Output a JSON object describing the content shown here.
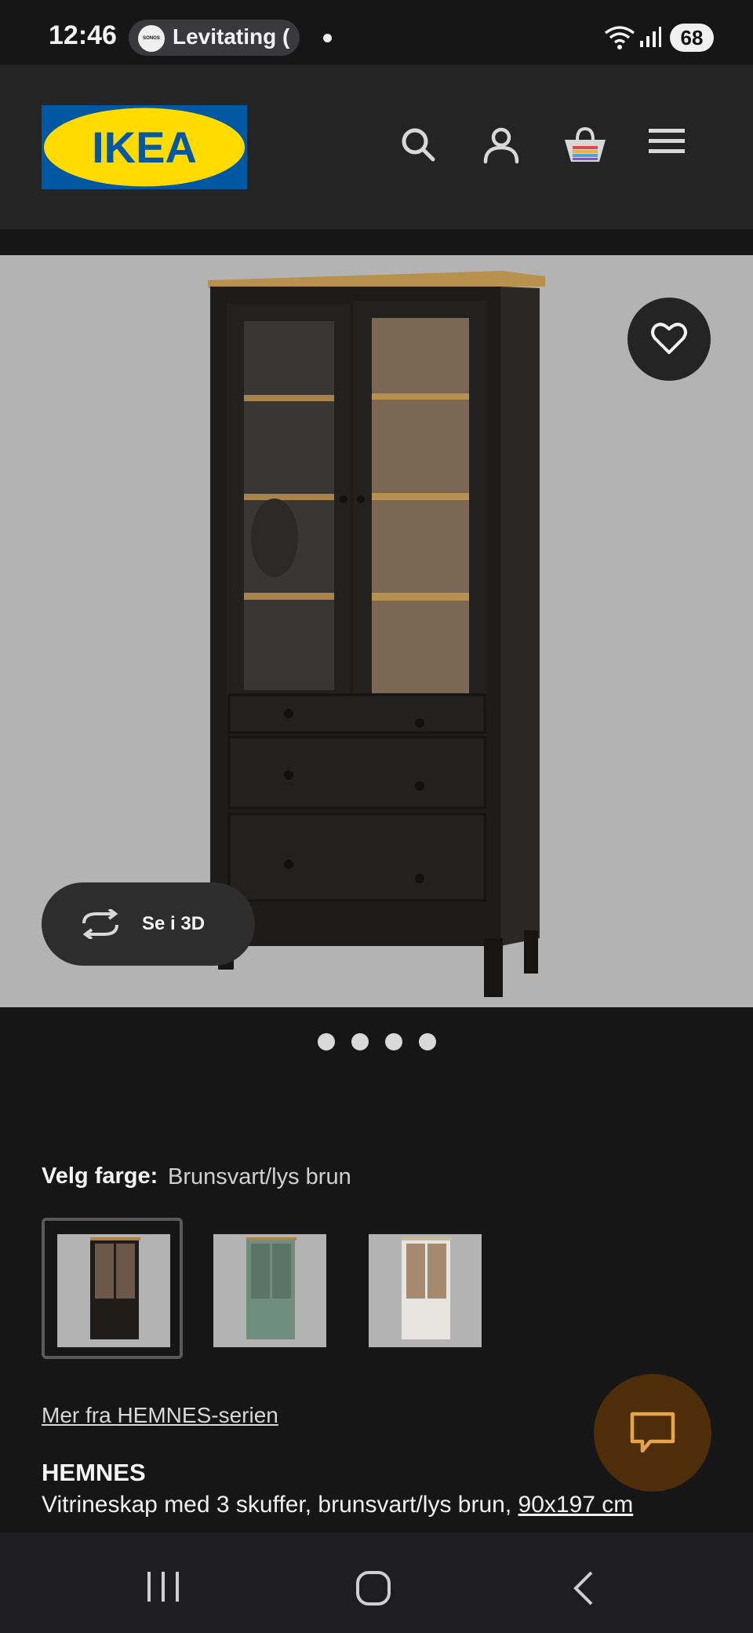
{
  "status_bar": {
    "time": "12:46",
    "media_app_logo": "SONOS",
    "media_text": "Levitating (",
    "battery": "68",
    "icons": [
      "wifi-icon",
      "signal-icon"
    ]
  },
  "header": {
    "logo_text": "IKEA",
    "icons": [
      "search-icon",
      "account-icon",
      "shopping-bag-icon",
      "menu-icon"
    ]
  },
  "product_image": {
    "alt_name": "HEMNES glass-door cabinet",
    "view_3d_label": "Se i 3D",
    "page_count": 4
  },
  "color_picker": {
    "label": "Velg farge:",
    "selected_value": "Brunsvart/lys brun",
    "swatches": [
      {
        "name": "black-brown",
        "color": "#1f1c1a",
        "selected": true
      },
      {
        "name": "grey-green",
        "color": "#6f8e7f",
        "selected": false
      },
      {
        "name": "white",
        "color": "#e7e5e0",
        "selected": false
      }
    ]
  },
  "series_link": "Mer fra HEMNES-serien",
  "product": {
    "name": "HEMNES",
    "description": "Vitrineskap med 3 skuffer, brunsvart/lys brun, ",
    "size": "90x197 cm"
  },
  "colors": {
    "background": "#161617",
    "header": "#242424",
    "ikea_blue": "#0058a3",
    "ikea_yellow": "#ffdb00",
    "chat_button": "#4e2e0a"
  }
}
